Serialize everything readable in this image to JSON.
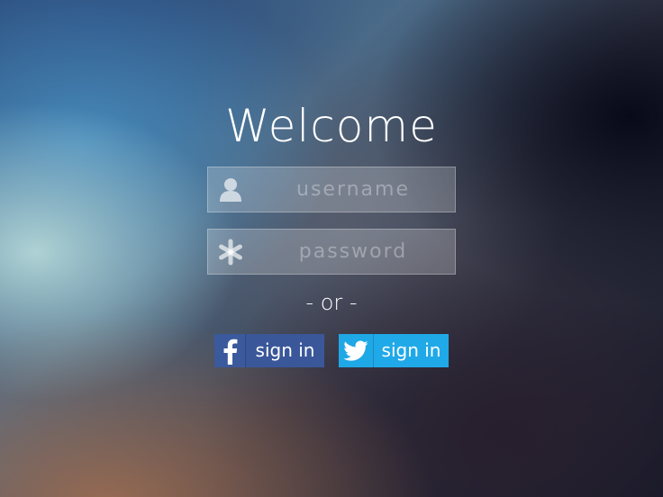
{
  "title": "Welcome",
  "username": {
    "placeholder": "username",
    "value": "",
    "icon": "user-icon"
  },
  "password": {
    "placeholder": "password",
    "value": "",
    "icon": "asterisk-icon"
  },
  "divider": "- or -",
  "social": {
    "facebook": {
      "label": "sign in",
      "icon": "facebook-icon",
      "color": "#3a579a"
    },
    "twitter": {
      "label": "sign in",
      "icon": "twitter-icon",
      "color": "#20a9e8"
    }
  }
}
